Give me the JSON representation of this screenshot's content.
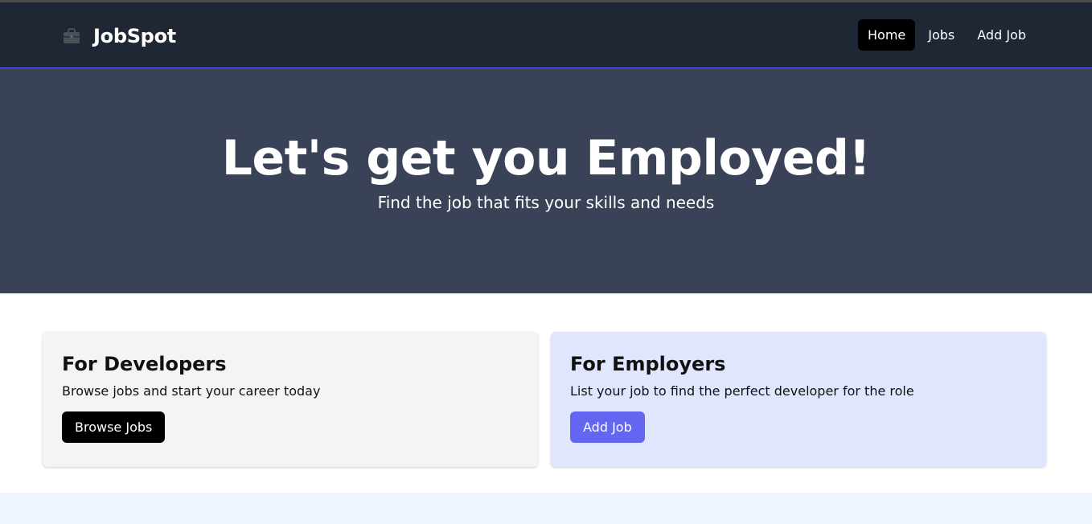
{
  "brand": {
    "name": "JobSpot",
    "icon": "briefcase-icon"
  },
  "nav": {
    "links": [
      {
        "label": "Home",
        "active": true
      },
      {
        "label": "Jobs",
        "active": false
      },
      {
        "label": "Add Job",
        "active": false
      }
    ]
  },
  "hero": {
    "title": "Let's get you Employed!",
    "subtitle": "Find the job that fits your skills and needs"
  },
  "cards": {
    "developers": {
      "title": "For Developers",
      "text": "Browse jobs and start your career today",
      "button": "Browse Jobs"
    },
    "employers": {
      "title": "For Employers",
      "text": "List your job to find the perfect developer for the role",
      "button": "Add Job"
    }
  },
  "colors": {
    "navbar": "#1f2634",
    "hero": "#394256",
    "accent": "#6366f1",
    "employer_card": "#e1e6ff",
    "developer_card": "#f3f4f6"
  }
}
